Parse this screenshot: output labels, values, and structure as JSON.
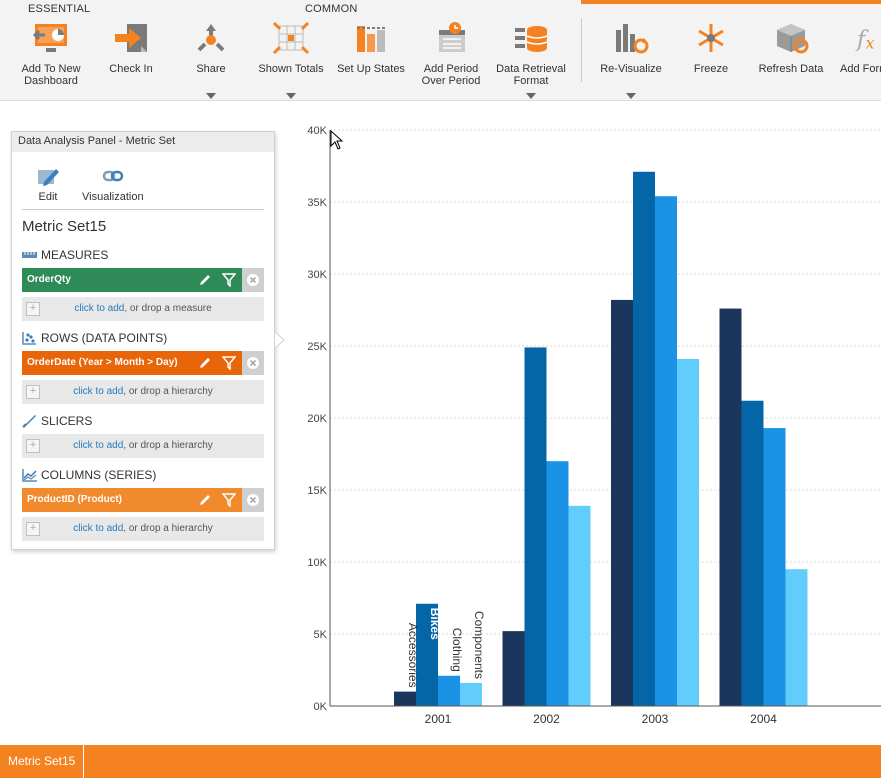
{
  "ribbon": {
    "groups": {
      "essential": "ESSENTIAL",
      "common": "COMMON"
    },
    "buttons": {
      "add_to_dashboard": "Add To New\nDashboard",
      "check_in": "Check In",
      "share": "Share",
      "shown_totals": "Shown Totals",
      "set_up_states": "Set Up States",
      "add_period": "Add Period\nOver Period",
      "data_retrieval": "Data Retrieval\nFormat",
      "revisualize": "Re-Visualize",
      "freeze": "Freeze",
      "refresh": "Refresh Data",
      "add_formula": "Add Formula"
    },
    "colors": {
      "accent": "#f58220",
      "icon_orange": "#f58220",
      "icon_gray": "#7a7a7a"
    }
  },
  "panel": {
    "title": "Data Analysis Panel - Metric Set",
    "tools": {
      "edit": "Edit",
      "visualization": "Visualization"
    },
    "metric_name": "Metric Set15",
    "sections": {
      "measures": "MEASURES",
      "rows": "ROWS (DATA POINTS)",
      "slicers": "SLICERS",
      "columns": "COLUMNS (SERIES)"
    },
    "chips": {
      "measure": "OrderQty",
      "row": "OrderDate (Year > Month > Day)",
      "column": "ProductID (Product)"
    },
    "add": {
      "link": "click to add",
      "measure_suffix": ", or drop a measure",
      "hierarchy_suffix": ", or drop a hierarchy"
    },
    "colors": {
      "measure": "#2e8b57",
      "row": "#e8650a",
      "column": "#f08a2c"
    }
  },
  "chart_data": {
    "type": "bar",
    "categories": [
      "2001",
      "2002",
      "2003",
      "2004"
    ],
    "series": [
      {
        "name": "Accessories",
        "color": "#1b365d",
        "values": [
          1000,
          5200,
          28200,
          27600
        ]
      },
      {
        "name": "Bikes",
        "color": "#0466a6",
        "values": [
          7100,
          24900,
          37100,
          21200
        ]
      },
      {
        "name": "Clothing",
        "color": "#1a93e6",
        "values": [
          2100,
          17000,
          35400,
          19300
        ]
      },
      {
        "name": "Components",
        "color": "#62cdfc",
        "values": [
          1600,
          13900,
          24100,
          9500
        ]
      }
    ],
    "ylim": [
      0,
      40000
    ],
    "yticks": [
      0,
      5000,
      10000,
      15000,
      20000,
      25000,
      30000,
      35000,
      40000
    ],
    "ytick_labels": [
      "0K",
      "5K",
      "10K",
      "15K",
      "20K",
      "25K",
      "30K",
      "35K",
      "40K"
    ],
    "grid": true,
    "legend": "inline-rotated-labels-on-first-category"
  },
  "status": {
    "tab": "Metric Set15"
  }
}
